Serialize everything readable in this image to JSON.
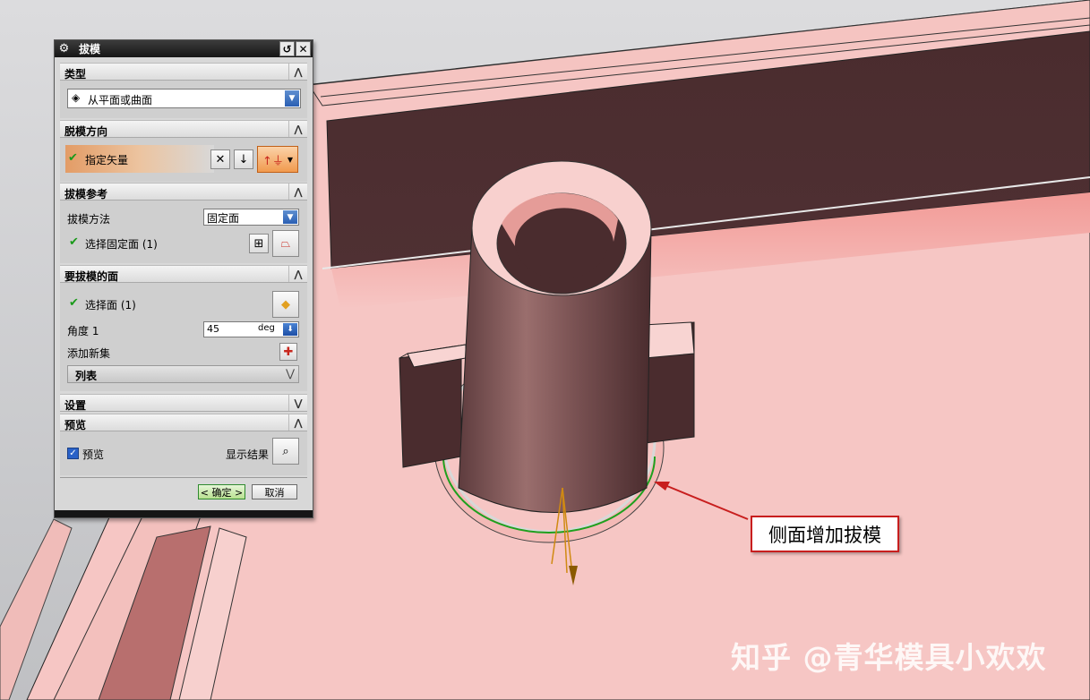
{
  "dialog": {
    "title": "拔模",
    "sections": {
      "type": {
        "label": "类型",
        "select_value": "从平面或曲面"
      },
      "direction": {
        "label": "脱模方向",
        "specify_vector": "指定矢量"
      },
      "reference": {
        "label": "拔模参考",
        "method_label": "拔模方法",
        "method_value": "固定面",
        "select_fixed": "选择固定面 (1)"
      },
      "faces": {
        "label": "要拔模的面",
        "select_face": "选择面 (1)",
        "angle_label": "角度 1",
        "angle_value": "45",
        "angle_unit": "deg",
        "add_set": "添加新集",
        "list_label": "列表"
      },
      "settings": {
        "label": "设置"
      },
      "preview": {
        "label": "预览",
        "checkbox_label": "预览",
        "show_result": "显示结果"
      }
    },
    "ok_label": "< 确定 >",
    "cancel_label": "取消"
  },
  "annotation": "侧面增加拔模",
  "watermark": "知乎 @青华模具小欢欢",
  "colors": {
    "model_face": "#f6c6c4",
    "model_dark": "#4a2c2e",
    "accent_green": "#1a9a1a",
    "callout_red": "#c81e1e"
  }
}
